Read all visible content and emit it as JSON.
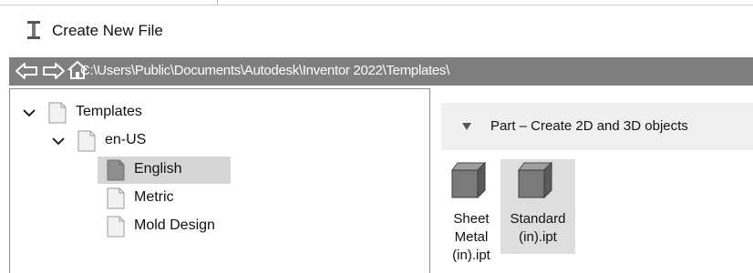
{
  "window": {
    "title": "Create New File",
    "icons": {
      "app": "inventor-app-icon"
    }
  },
  "addressbar": {
    "path": "C:\\Users\\Public\\Documents\\Autodesk\\Inventor 2022\\Templates\\",
    "icons": {
      "back": "back-arrow-icon",
      "forward": "forward-arrow-icon",
      "home": "home-icon"
    }
  },
  "tree": {
    "items": [
      {
        "label": "Templates",
        "expanded": true,
        "selected": false
      },
      {
        "label": "en-US",
        "expanded": true,
        "selected": false
      },
      {
        "label": "English",
        "selected": true
      },
      {
        "label": "Metric",
        "selected": false
      },
      {
        "label": "Mold Design",
        "selected": false
      }
    ]
  },
  "main": {
    "group_label": "Part – Create 2D and 3D objects",
    "templates": [
      {
        "line1": "Sheet",
        "line2": "Metal",
        "line3": "(in).ipt",
        "selected": false
      },
      {
        "line1": "Standard",
        "line2": "(in).ipt",
        "selected": true
      }
    ]
  },
  "colors": {
    "addressbar_bg": "#7f7f7f",
    "selection_bg": "#d6d6d6",
    "group_bg": "#f0f0f0"
  }
}
